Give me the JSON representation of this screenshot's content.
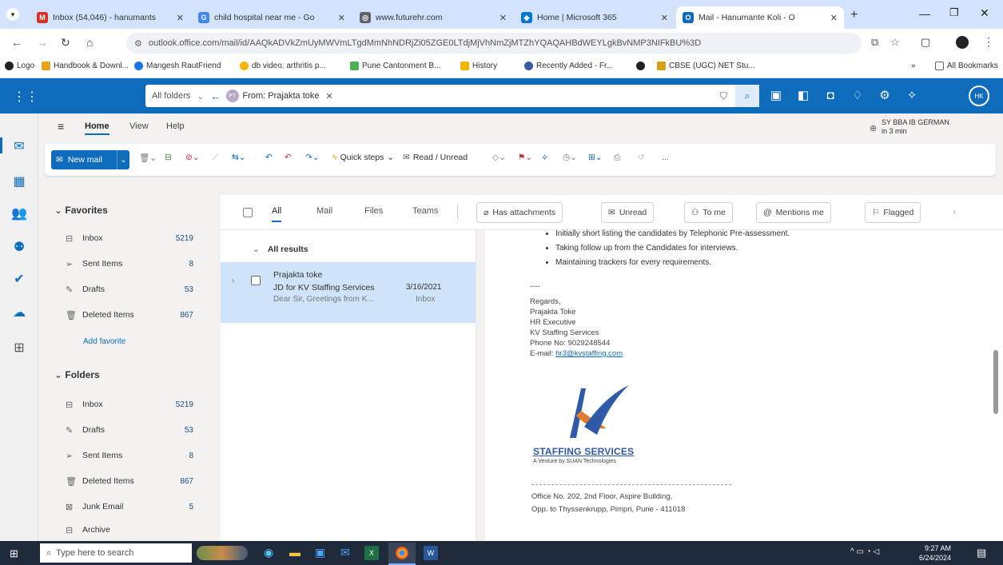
{
  "browser": {
    "tabs": [
      {
        "title": "Inbox (54,046) - hanumants",
        "color": "#d93025",
        "active": false
      },
      {
        "title": "child hospital near me - Go",
        "color": "#4285f4",
        "active": false
      },
      {
        "title": "www.futurehr.com",
        "color": "#5f6368",
        "active": false
      },
      {
        "title": "Home | Microsoft 365",
        "color": "#0078d4",
        "active": false
      },
      {
        "title": "Mail - Hanumante Koli - O",
        "color": "#0f6cbd",
        "active": true
      }
    ],
    "new_tab_label": "+",
    "url": "outlook.office.com/mail/id/AAQkADVkZmUyMWVmLTgdMmNhNDRjZi05ZGE0LTdjMjVhNmZjMTZhYQAQAHBdWEYLgkBvNMP3NIFkBU%3D",
    "bookmarks": [
      "Logo",
      "Handbook & Downl...",
      "Mangesh RautFriend",
      "db video: arthritis p...",
      "Pune Cantonment B...",
      "History",
      "Recently Added - Fr...",
      "",
      "CBSE (UGC) NET Stu...",
      "»",
      "All Bookmarks"
    ]
  },
  "outlook": {
    "search_scope": "All folders",
    "search_query": "From: Prajakta toke",
    "menu_tabs": [
      "Home",
      "View",
      "Help"
    ],
    "reminder": {
      "title": "SY BBA IB GERMAN",
      "time": "in 3 min"
    },
    "ribbon": {
      "new_mail": "New mail",
      "quick_steps": "Quick steps",
      "read_unread": "Read / Unread",
      "more": "..."
    },
    "favorites": {
      "header": "Favorites",
      "items": [
        {
          "label": "Inbox",
          "count": "5219",
          "icon": "inbox-icon"
        },
        {
          "label": "Sent Items",
          "count": "8",
          "icon": "sent-icon"
        },
        {
          "label": "Drafts",
          "count": "53",
          "icon": "drafts-icon"
        },
        {
          "label": "Deleted Items",
          "count": "867",
          "icon": "trash-icon"
        }
      ],
      "add_favorite": "Add favorite"
    },
    "folders": {
      "header": "Folders",
      "items": [
        {
          "label": "Inbox",
          "count": "5219",
          "icon": "inbox-icon"
        },
        {
          "label": "Drafts",
          "count": "53",
          "icon": "drafts-icon"
        },
        {
          "label": "Sent Items",
          "count": "8",
          "icon": "sent-icon"
        },
        {
          "label": "Deleted Items",
          "count": "867",
          "icon": "trash-icon"
        },
        {
          "label": "Junk Email",
          "count": "5",
          "icon": "junk-icon"
        },
        {
          "label": "Archive",
          "count": "",
          "icon": "archive-icon"
        }
      ]
    },
    "filters": {
      "tabs": [
        "All",
        "Mail",
        "Files",
        "Teams"
      ],
      "chips": [
        "Has attachments",
        "Unread",
        "To me",
        "Mentions me",
        "Flagged"
      ]
    },
    "results": {
      "header": "All results",
      "messages": [
        {
          "sender": "Prajakta toke",
          "subject": "JD for KV Staffing Services",
          "date": "3/16/2021",
          "preview": "Dear Sir, Greetings from K...",
          "folder": "Inbox"
        }
      ]
    },
    "email_body": {
      "bullets": [
        "Initially short listing the candidates by Telephonic Pre-assessment.",
        "Taking follow up from the Candidates for interviews.",
        "Maintaining trackers for every requirements."
      ],
      "sig_sep": "----",
      "regards": "Regards,",
      "name": "Prajakta Toke",
      "title": "HR Executive",
      "company": "KV Staffing Services",
      "phone": "Phone No: 9029248544",
      "email_label": "E-mail:",
      "email": "hr3@kvstaffing.com",
      "logo_name": "STAFFING SERVICES",
      "logo_tagline": "A Venture by SUAN Technologies",
      "address_line1": "Office No. 202, 2nd Floor, Aspire Building,",
      "address_line2": "Opp. to Thyssenkrupp, Pimpri, Pune - 411018"
    }
  },
  "taskbar": {
    "search_placeholder": "Type here to search",
    "time": "9:27 AM",
    "date": "6/24/2024"
  },
  "colors": {
    "accent": "#0f6cbd",
    "selected": "#cfe4fa",
    "taskbar": "#1f2a3a"
  }
}
